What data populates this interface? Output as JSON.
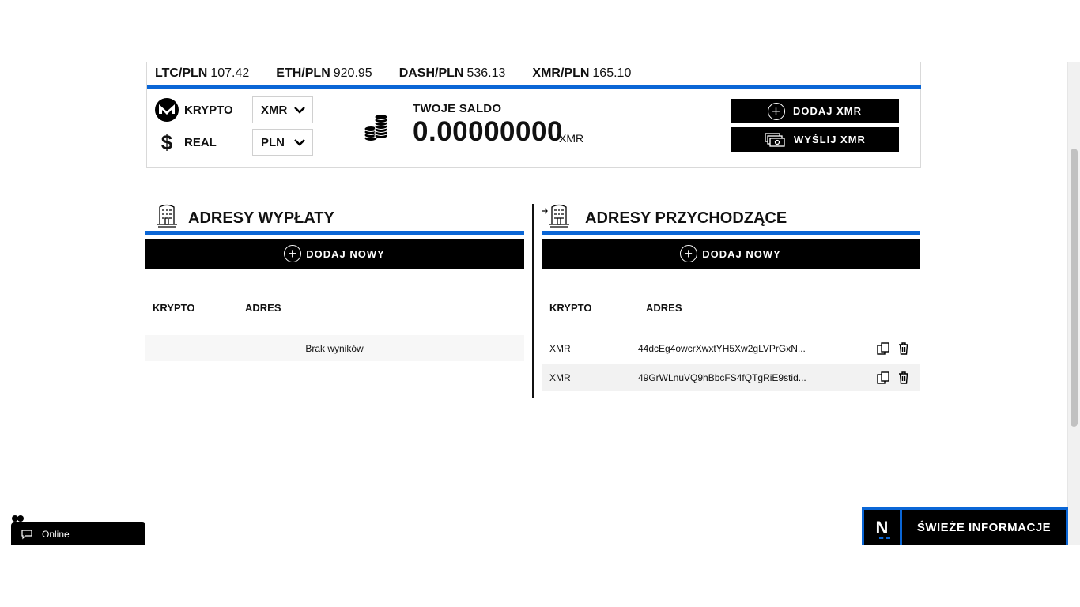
{
  "ticker": [
    {
      "pair": "LTC/PLN",
      "value": "107.42"
    },
    {
      "pair": "ETH/PLN",
      "value": "920.95"
    },
    {
      "pair": "DASH/PLN",
      "value": "536.13"
    },
    {
      "pair": "XMR/PLN",
      "value": "165.10"
    }
  ],
  "currency": {
    "crypto_label": "KRYPTO",
    "crypto_value": "XMR",
    "real_label": "REAL",
    "real_value": "PLN",
    "real_symbol": "$"
  },
  "balance": {
    "label": "TWOJE SALDO",
    "amount": "0.00000000",
    "unit": "XMR"
  },
  "actions": {
    "add": "DODAJ XMR",
    "send": "WYŚLIJ XMR",
    "plus": "+"
  },
  "withdraw": {
    "title": "ADRESY WYPŁATY",
    "add_new": "DODAJ NOWY",
    "headers": [
      "KRYPTO",
      "ADRES"
    ],
    "empty": "Brak wyników"
  },
  "incoming": {
    "title": "ADRESY PRZYCHODZĄCE",
    "add_new": "DODAJ NOWY",
    "headers": [
      "KRYPTO",
      "ADRES"
    ],
    "rows": [
      {
        "crypto": "XMR",
        "address": "44dcEg4owcrXwxtYH5Xw2gLVPrGxN..."
      },
      {
        "crypto": "XMR",
        "address": "49GrWLnuVQ9hBbcFS4fQTgRiE9stid..."
      }
    ]
  },
  "chat": {
    "status": "Online"
  },
  "news": {
    "logo": "N",
    "label": "ŚWIEŻE INFORMACJE"
  },
  "colors": {
    "accent": "#0a66d6",
    "dark": "#000000"
  }
}
